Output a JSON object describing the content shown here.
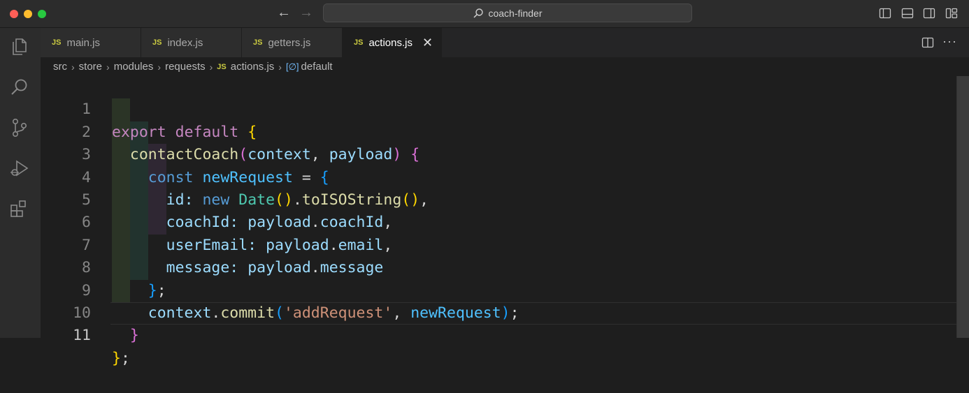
{
  "window": {
    "search_text": "coach-finder"
  },
  "tabs": [
    {
      "badge": "JS",
      "label": "main.js",
      "active": false
    },
    {
      "badge": "JS",
      "label": "index.js",
      "active": false
    },
    {
      "badge": "JS",
      "label": "getters.js",
      "active": false
    },
    {
      "badge": "JS",
      "label": "actions.js",
      "active": true
    }
  ],
  "breadcrumb": {
    "items": [
      "src",
      "store",
      "modules",
      "requests"
    ],
    "file_badge": "JS",
    "file": "actions.js",
    "symbol": "default"
  },
  "editor": {
    "line_numbers": [
      "1",
      "2",
      "3",
      "4",
      "5",
      "6",
      "7",
      "8",
      "9",
      "10",
      "11"
    ],
    "code_lines": [
      "export default {",
      "  contactCoach(context, payload) {",
      "    const newRequest = {",
      "      id: new Date().toISOString(),",
      "      coachId: payload.coachId,",
      "      userEmail: payload.email,",
      "      message: payload.message",
      "    };",
      "    context.commit('addRequest', newRequest);",
      "  }",
      "};"
    ],
    "current_line": 11
  },
  "colors": {
    "keyword": "#c586c0",
    "storage": "#569cd6",
    "function": "#dcdcaa",
    "variable": "#9cdcfe",
    "constant": "#4fc1ff",
    "class": "#4ec9b0",
    "string": "#ce9178",
    "bracket_1": "#ffd700",
    "bracket_2": "#da70d6",
    "bracket_3": "#179fff",
    "js_badge": "#cbcb41"
  },
  "icons": {
    "activity_bar": [
      "explorer-icon",
      "search-icon",
      "source-control-icon",
      "run-debug-icon",
      "extensions-icon"
    ],
    "title_right": [
      "toggle-primary-sidebar-icon",
      "toggle-panel-icon",
      "toggle-secondary-sidebar-icon",
      "customize-layout-icon"
    ],
    "editor_actions": [
      "split-editor-icon",
      "more-actions-icon"
    ]
  }
}
